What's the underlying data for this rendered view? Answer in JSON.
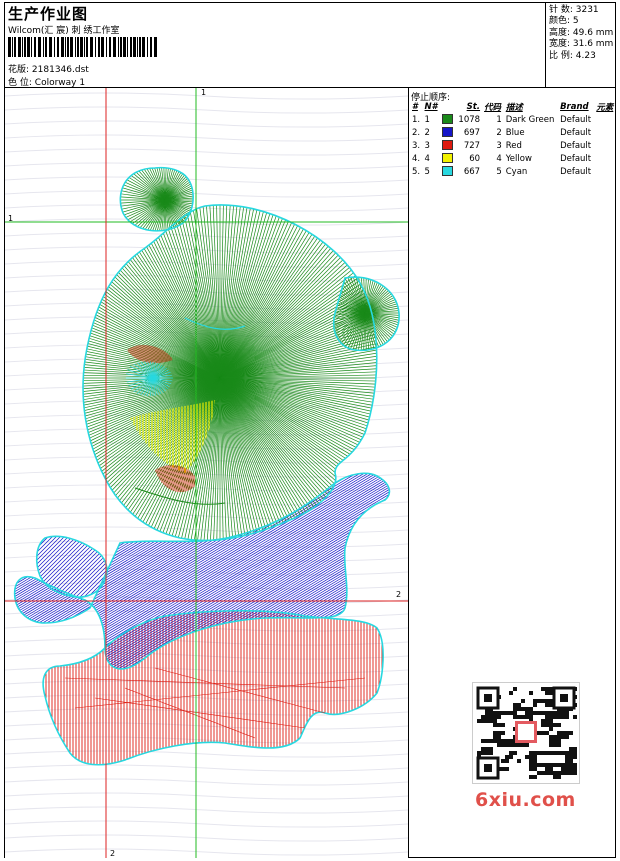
{
  "header": {
    "title": "生产作业图",
    "company": "Wilcom(汇 宸) 刺 绣工作室",
    "design_label": "花版:",
    "design_value": "2181346.dst",
    "colorway_label": "色 位:",
    "colorway_value": "Colorway 1"
  },
  "specs": {
    "stitches": "针 数: 3231",
    "colors": "颜色: 5",
    "height": "高度: 49.6 mm",
    "width": "宽度: 31.6 mm",
    "scale": "比 例: 4.23"
  },
  "stop_sequence": {
    "title": "停止顺序:",
    "headers": [
      "#",
      "N#",
      "St.",
      "代码",
      "描述",
      "Brand",
      "元素"
    ],
    "rows": [
      {
        "num": "1.",
        "n": "1",
        "color": "#1a8a1a",
        "st": "1078",
        "code": "1",
        "desc": "Dark Green",
        "brand": "Default"
      },
      {
        "num": "2.",
        "n": "2",
        "color": "#1515c8",
        "st": "697",
        "code": "2",
        "desc": "Blue",
        "brand": "Default"
      },
      {
        "num": "3.",
        "n": "3",
        "color": "#dd1a10",
        "st": "727",
        "code": "3",
        "desc": "Red",
        "brand": "Default"
      },
      {
        "num": "4.",
        "n": "4",
        "color": "#f2f200",
        "st": "60",
        "code": "4",
        "desc": "Yellow",
        "brand": "Default"
      },
      {
        "num": "5.",
        "n": "5",
        "color": "#28d8e0",
        "st": "667",
        "code": "5",
        "desc": "Cyan",
        "brand": "Default"
      }
    ]
  },
  "guides": {
    "top": "1",
    "left": "1",
    "right": "2",
    "bottom": "2"
  },
  "watermark": "6xiu.com",
  "colors": {
    "green": "#1a8a1a",
    "blue": "#1515c8",
    "red": "#dd1a10",
    "yellow": "#f2f200",
    "cyan": "#28d8e0",
    "guide_green": "#22bb22",
    "guide_red": "#dd2222"
  }
}
